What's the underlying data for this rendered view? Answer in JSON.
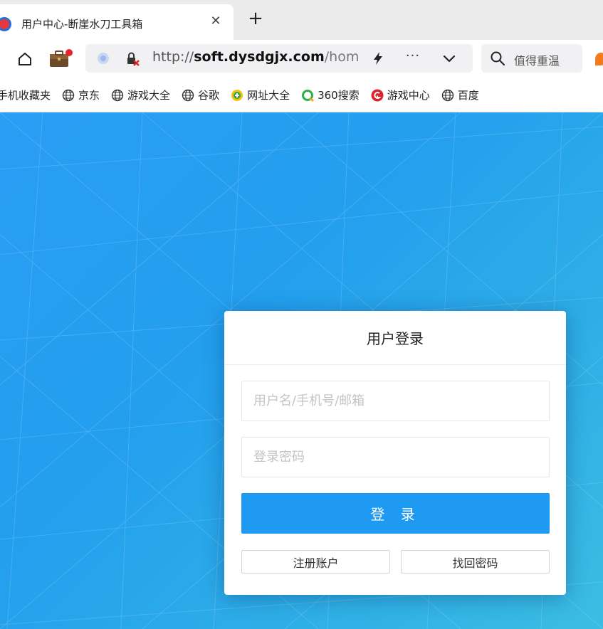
{
  "browser": {
    "tab": {
      "title": "用户中心-断崖水刀工具箱",
      "close": "✕",
      "new_tab": "+"
    },
    "url": {
      "scheme": "http://",
      "domain": "soft.dysdgjx.com",
      "path": "/hom"
    },
    "toolbar": {
      "more": "···"
    },
    "search": {
      "text": "值得重温"
    },
    "bookmarks": [
      {
        "label": "手机收藏夹",
        "icon": "none"
      },
      {
        "label": "京东",
        "icon": "globe-icon"
      },
      {
        "label": "游戏大全",
        "icon": "globe-icon"
      },
      {
        "label": "谷歌",
        "icon": "globe-icon"
      },
      {
        "label": "网址大全",
        "icon": "hao123-icon"
      },
      {
        "label": "360搜索",
        "icon": "360-search-icon"
      },
      {
        "label": "游戏中心",
        "icon": "game-center-icon"
      },
      {
        "label": "百度",
        "icon": "globe-icon"
      }
    ]
  },
  "login": {
    "title": "用户登录",
    "username_placeholder": "用户名/手机号/邮箱",
    "password_placeholder": "登录密码",
    "submit_label": "登 录",
    "register_label": "注册账户",
    "recover_label": "找回密码"
  },
  "colors": {
    "page_gradient_start": "#2a9df4",
    "page_gradient_end": "#3bbde3",
    "primary_button": "#1e9af2",
    "tab_bar": "#ebebeb"
  }
}
